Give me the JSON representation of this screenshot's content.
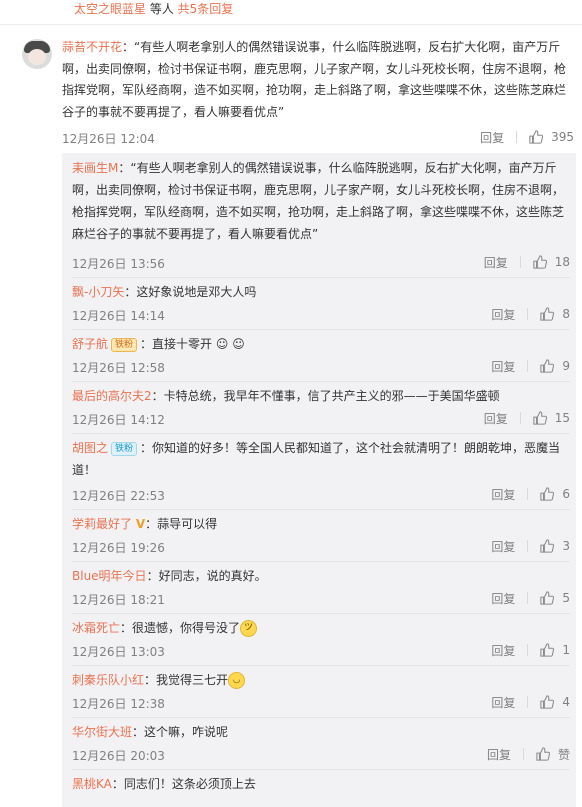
{
  "top": {
    "name": "太空之眼蓝星",
    "middle": " 等人 ",
    "link": "共5条回复"
  },
  "main_comment": {
    "user": "蒜苔不开花",
    "text": "：“有些人啊老拿别人的偶然错误说事，什么临阵脱逃啊，反右扩大化啊，亩产万斤啊，出卖同僚啊，检讨书保证书啊，鹿克思啊，儿子家产啊，女儿斗死校长啊，住房不退啊，枪指挥党啊，军队经商啊，造不如买啊，抢功啊，走上斜路了啊，拿这些喋喋不休，这些陈芝麻烂谷子的事就不要再提了，看人嘛要看优点”",
    "time": "12月26日 12:04",
    "reply_label": "回复",
    "likes": "395"
  },
  "replies": [
    {
      "user": "耒画生M",
      "text": "：“有些人啊老拿别人的偶然错误说事，什么临阵脱逃啊，反右扩大化啊，亩产万斤啊，出卖同僚啊，检讨书保证书啊，鹿克思啊，儿子家产啊，女儿斗死校长啊，住房不退啊，枪指挥党啊，军队经商啊，造不如买啊，抢功啊，走上斜路了啊，拿这些喋喋不休，这些陈芝麻烂谷子的事就不要再提了，看人嘛要看优点”",
      "time": "12月26日 13:56",
      "reply_label": "回复",
      "likes": "18"
    },
    {
      "user": "飘-小刀矢",
      "text": "：这好象说地是邓大人吗",
      "time": "12月26日 14:14",
      "reply_label": "回复",
      "likes": "8"
    },
    {
      "user": "舒子航",
      "badge": "铁粉",
      "text": "：直接十零开",
      "emoji": "☺ ☺",
      "time": "12月26日 12:58",
      "reply_label": "回复",
      "likes": "9"
    },
    {
      "user": "最后的高尔夫2",
      "text": "：卡特总统，我早年不懂事，信了共产主义的邪——于美国华盛顿",
      "time": "12月26日 14:12",
      "reply_label": "回复",
      "likes": "15"
    },
    {
      "user": "胡图之",
      "badge": "铁粉",
      "text": "：你知道的好多！等全国人民都知道了，这个社会就清明了！朗朗乾坤，恶魔当道！",
      "time": "12月26日 22:53",
      "reply_label": "回复",
      "likes": "6"
    },
    {
      "user": "学莉最好了",
      "vmark": "V",
      "text": "：蒜导可以得",
      "time": "12月26日 19:26",
      "reply_label": "回复",
      "likes": "3"
    },
    {
      "user": "Blue明年今日",
      "text": "：好同志，说的真好。",
      "time": "12月26日 18:21",
      "reply_label": "回复",
      "likes": "5"
    },
    {
      "user": "冰霜死亡",
      "text": "：很遗憾，你得号没了",
      "emoji": "ツ",
      "time": "12月26日 13:03",
      "reply_label": "回复",
      "likes": "1"
    },
    {
      "user": "刺秦乐队小红",
      "text": "：我觉得三七开",
      "emoji": "◡",
      "time": "12月26日 12:38",
      "reply_label": "回复",
      "likes": "4"
    },
    {
      "user": "华尔街大班",
      "text": "：这个嘛，咋说呢",
      "time": "12月26日 20:03",
      "reply_label": "回复",
      "likes": "赞"
    },
    {
      "user": "黑桃KA",
      "text": "：同志们！这条必须顶上去"
    }
  ],
  "colors": {
    "username": "#eb7350",
    "meta": "#808080",
    "panel_bg": "#f2f2f5"
  }
}
